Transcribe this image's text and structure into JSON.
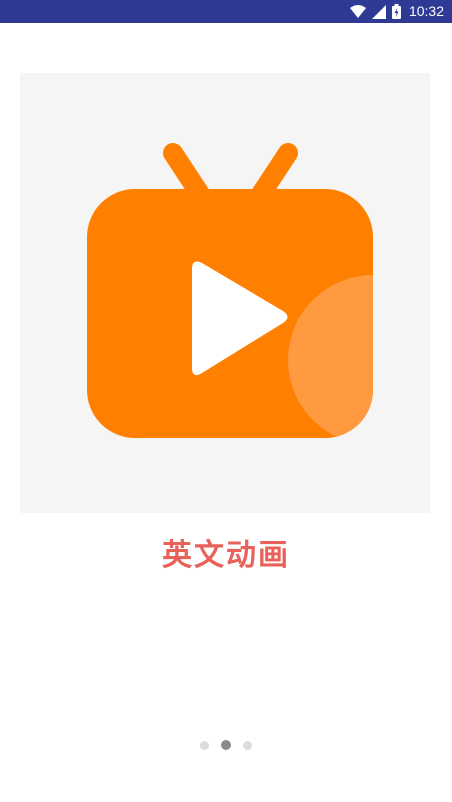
{
  "status_bar": {
    "time": "10:32",
    "icons": [
      "wifi-icon",
      "signal-icon",
      "battery-icon"
    ],
    "background": "#2f3a95"
  },
  "illustration": {
    "icon": "tv-play-icon",
    "primary_color": "#ff8000",
    "accent_color": "#ff9a40",
    "background": "#f5f5f5"
  },
  "slide": {
    "title": "英文动画",
    "title_color": "#e8625a"
  },
  "pager": {
    "total": 3,
    "current": 2,
    "active_color": "#8a8a8a",
    "inactive_color": "#dcdcdc"
  }
}
